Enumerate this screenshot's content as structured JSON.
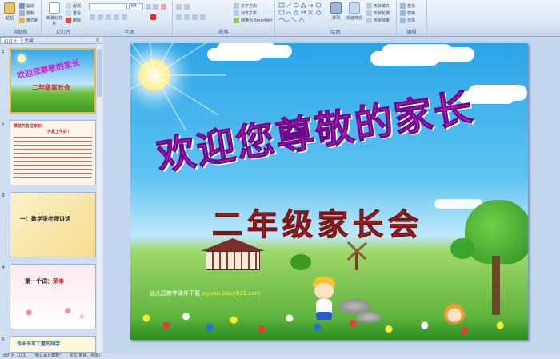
{
  "ribbon": {
    "clipboard": {
      "label": "剪贴板",
      "paste": "粘贴",
      "cut": "剪切",
      "copy": "复制",
      "format_painter": "格式刷"
    },
    "slides": {
      "label": "幻灯片",
      "new_slide": "新建幻灯片",
      "layout": "版式",
      "reset": "重设",
      "delete": "删除"
    },
    "font": {
      "label": "字体",
      "font_size": "54"
    },
    "paragraph": {
      "label": "段落",
      "text_direction": "文字方向",
      "align_text": "对齐文本",
      "smartart": "转换为 SmartArt"
    },
    "drawing": {
      "label": "绘图",
      "arrange": "排列",
      "quick_styles": "快速样式",
      "shape_fill": "形状填充",
      "shape_outline": "形状轮廓",
      "shape_effects": "形状效果"
    },
    "editing": {
      "label": "编辑",
      "find": "查找",
      "replace": "替换",
      "select": "选择"
    }
  },
  "leftpane": {
    "tabs": [
      "幻灯片",
      "大纲"
    ],
    "close": "×",
    "thumbs": [
      {
        "num": "1",
        "title": "欢迎您尊敬的家长",
        "subtitle": "二年级家长会"
      },
      {
        "num": "2",
        "line1": "尊敬的各位家长：",
        "line2": "大家上午好！"
      },
      {
        "num": "3",
        "line1": "一：数学张老师讲话"
      },
      {
        "num": "4",
        "line1": "第一个词：",
        "line1b": "荣幸"
      },
      {
        "num": "5",
        "line1": "作业书写工整的同学"
      }
    ]
  },
  "slide": {
    "title": "欢迎您尊敬的家长",
    "subtitle": "二年级家长会",
    "footer_prefix": "幼儿园教学课件下载",
    "footer_site": "ziyuan.baby611.com"
  },
  "statusbar": {
    "slide_info": "幻灯片 1/21",
    "theme": "\"默认设计模板\"",
    "lang": "中文(简体，中国)"
  },
  "colors": {
    "title_magenta": "#d41ac8",
    "subtitle_red": "#c0312e",
    "accent": "#f0b83a"
  }
}
